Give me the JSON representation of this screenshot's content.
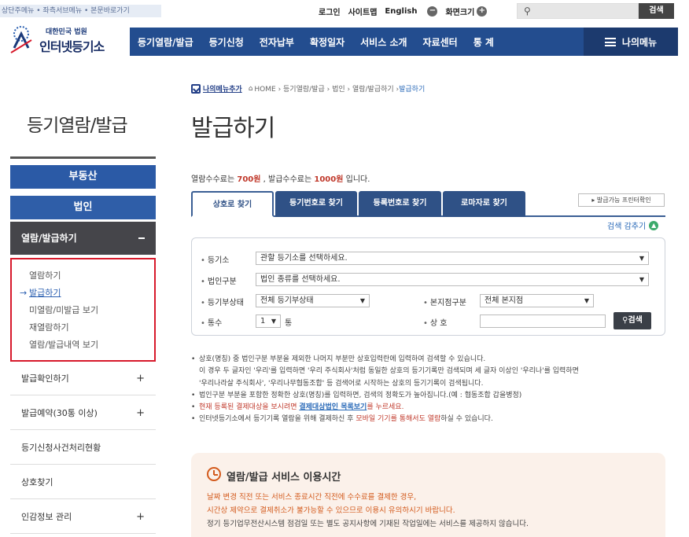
{
  "util": {
    "skip_links": "상단주메뉴 • 좌측서브메뉴 • 본문바로가기",
    "login": "로그인",
    "sitemap": "사이트맵",
    "english": "English",
    "zoom_label": "화면크기",
    "zoom_out": "−",
    "zoom_in": "+",
    "search_button": "검색"
  },
  "logo": {
    "small": "대한민국 법원",
    "big": "인터넷등기소"
  },
  "gnb": [
    "등기열람/발급",
    "등기신청",
    "전자납부",
    "확정일자",
    "서비스 소개",
    "자료센터",
    "통 계"
  ],
  "my_menu": "나의메뉴",
  "breadcrumb": {
    "favorite": "나의메뉴추가",
    "path": "HOME › 등기열람/발급 › 법인 › 열람/발급하기 ›",
    "current": "발급하기"
  },
  "side_title": "등기열람/발급",
  "page_title": "발급하기",
  "lnb": {
    "realty": "부동산",
    "corp": "법인",
    "active": "열람/발급하기",
    "sub": [
      "열람하기",
      "발급하기",
      "미열람/미발급 보기",
      "재열람하기",
      "열람/발급내역 보기"
    ],
    "items": [
      {
        "label": "발급확인하기",
        "plus": "+"
      },
      {
        "label": "발급예약(30통 이상)",
        "plus": "+"
      },
      {
        "label": "등기신청사건처리현황",
        "plus": ""
      },
      {
        "label": "상호찾기",
        "plus": ""
      },
      {
        "label": "인감정보 관리",
        "plus": "+"
      }
    ]
  },
  "fee": {
    "p1": "열람수수료는 ",
    "view_fee": "700원",
    "p2": " , 발급수수료는 ",
    "issue_fee": "1000원",
    "p3": " 입니다."
  },
  "tabs": [
    "상호로 찾기",
    "등기번호로 찾기",
    "등록번호로 찾기",
    "로마자로 찾기"
  ],
  "issue_check": "▸ 발급가능 프린터확인",
  "fold": "검색 감추기",
  "form": {
    "office_label": "등기소",
    "office_value": "관할 등기소를 선택하세요.",
    "type_label": "법인구분",
    "type_value": "법인 종류를 선택하세요.",
    "status_label": "등기부상태",
    "status_value": "전체 등기부상태",
    "branch_label": "본지점구분",
    "branch_value": "전체 본지점",
    "count_label": "통수",
    "count_value": "1",
    "count_unit": "통",
    "name_label": "상 호",
    "search": "검색"
  },
  "notes": {
    "n1": "상호(명칭) 중 법인구분 부분을 제외한 나머지 부분만 상호입력란에 입력하여 검색할 수 있습니다.",
    "n1b": "이 경우 두 글자인 '우리'를 입력하면 '우리 주식회사'처럼 동일한 상호의 등기기록만 검색되며 세 글자 이상인 '우리나'를 입력하면",
    "n1c": "'우리나라살 주식회사', '우리나무협동조합' 등 검색어로 시작하는 상호의 등기기록이 검색됩니다.",
    "n2": "법인구분 부분을 포함한 정확한 상호(명칭)를 입력하면, 검색의 정확도가 높아집니다.(예 : 협동조합 갑을병정)",
    "n3a": "현재 등록된 결제대상을 보시려면 ",
    "n3link": "결제대상법인 목록보기",
    "n3b": "를 누르세요.",
    "n4a": "인터넷등기소에서 등기기록 열람을 위해 결제하신 후 ",
    "n4red": "모바일 기기를 통해서도 열람",
    "n4b": "하실 수 있습니다."
  },
  "service": {
    "title": "열람/발급 서비스 이용시간",
    "l1": "날짜 변경 직전 또는 서비스 종료시간 직전에 수수료를 결제한 경우,",
    "l2": "시간상 제약으로 결제취소가 불가능할 수 있으므로 이용시 유의하시기 바랍니다.",
    "l3": "정기 등기업무전산시스템 점검일 또는 별도 공지사항에 기재된 작업일에는 서비스를 제공하지 않습니다."
  },
  "colors": {
    "primary": "#234d8f",
    "accent_red": "#d7192b",
    "text_red": "#c0392b",
    "active_menu": "#45454a"
  }
}
